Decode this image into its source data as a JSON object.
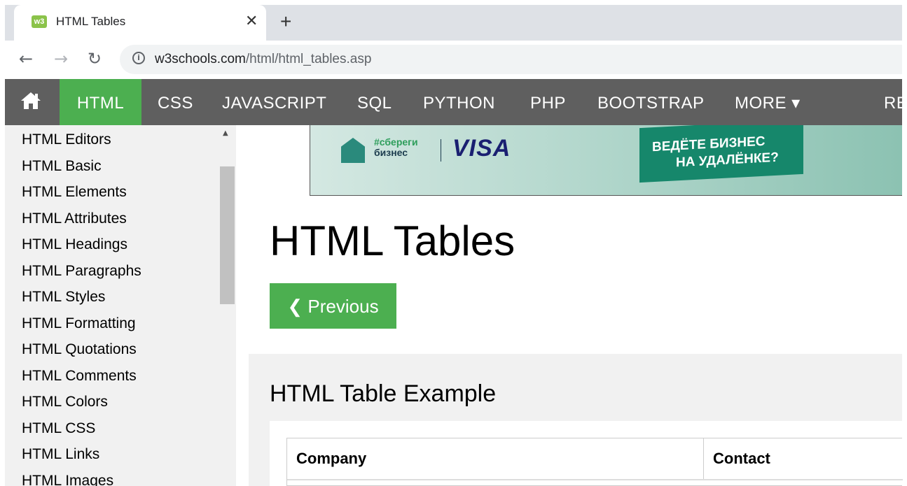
{
  "browser": {
    "tab_title": "HTML Tables",
    "favicon_text": "w3",
    "close_glyph": "✕",
    "new_tab_glyph": "+",
    "url_host": "w3schools.com",
    "url_path": "/html/html_tables.asp",
    "info_glyph": "i",
    "back_glyph": "←",
    "forward_glyph": "→",
    "reload_glyph": "↻"
  },
  "topnav": {
    "home_icon": "home-icon",
    "items": [
      "HTML",
      "CSS",
      "JAVASCRIPT",
      "SQL",
      "PYTHON",
      "PHP",
      "BOOTSTRAP",
      "MORE ▾",
      "RE"
    ],
    "active": "HTML",
    "active_color": "#4caf50",
    "bar_color": "#5f5f5f"
  },
  "sidebar": {
    "links": [
      "HTML Editors",
      "HTML Basic",
      "HTML Elements",
      "HTML Attributes",
      "HTML Headings",
      "HTML Paragraphs",
      "HTML Styles",
      "HTML Formatting",
      "HTML Quotations",
      "HTML Comments",
      "HTML Colors",
      "HTML CSS",
      "HTML Links",
      "HTML Images"
    ]
  },
  "ad": {
    "hashtag_line1": "#сбереги",
    "hashtag_line2": "бизнес",
    "brand": "VISA",
    "banner_line1": "ВЕДЁТЕ БИЗНЕС",
    "banner_line2": "НА УДАЛЁНКЕ?"
  },
  "main": {
    "title": "HTML Tables",
    "previous_label": "❮ Previous",
    "example_heading": "HTML Table Example",
    "table_headers": [
      "Company",
      "Contact"
    ]
  }
}
